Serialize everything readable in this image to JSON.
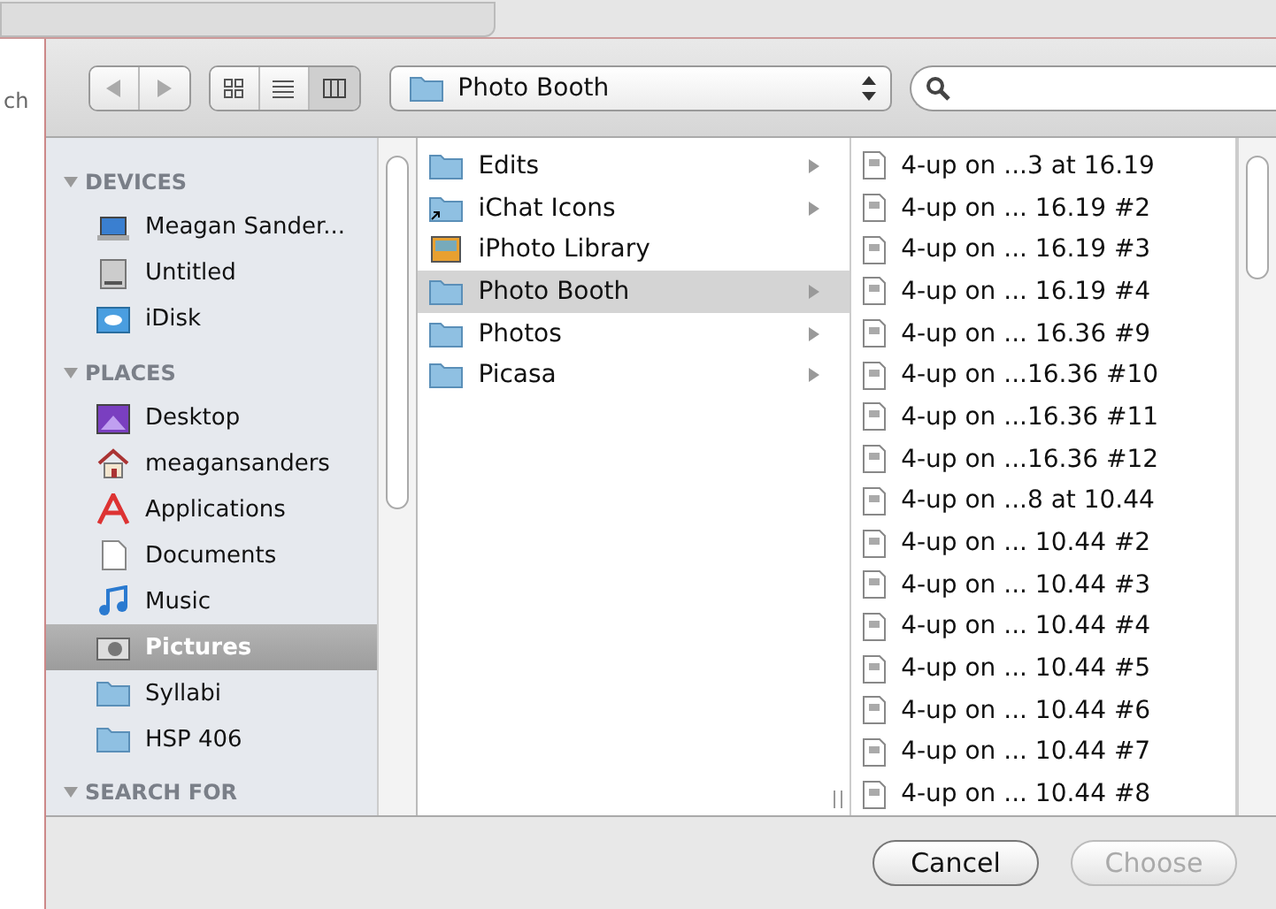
{
  "background": {
    "side_text": "ch"
  },
  "toolbar": {
    "nav": [
      {
        "kind": "back",
        "disabled": true
      },
      {
        "kind": "forward",
        "disabled": true
      }
    ],
    "views": [
      {
        "kind": "icons",
        "selected": false
      },
      {
        "kind": "list",
        "selected": false
      },
      {
        "kind": "columns",
        "selected": true
      }
    ],
    "location": "Photo Booth"
  },
  "sidebar": [
    {
      "heading": "DEVICES",
      "expanded": true,
      "items": [
        {
          "label": "Meagan Sander...",
          "kind": "laptop",
          "selected": false
        },
        {
          "label": "Untitled",
          "kind": "drive",
          "selected": false
        },
        {
          "label": "iDisk",
          "kind": "idisk",
          "selected": false
        }
      ]
    },
    {
      "heading": "PLACES",
      "expanded": true,
      "items": [
        {
          "label": "Desktop",
          "kind": "desktop",
          "selected": false
        },
        {
          "label": "meagansanders",
          "kind": "home",
          "selected": false
        },
        {
          "label": "Applications",
          "kind": "applications",
          "selected": false
        },
        {
          "label": "Documents",
          "kind": "documents",
          "selected": false
        },
        {
          "label": "Music",
          "kind": "music",
          "selected": false
        },
        {
          "label": "Pictures",
          "kind": "pictures",
          "selected": true
        },
        {
          "label": "Syllabi",
          "kind": "folder",
          "selected": false
        },
        {
          "label": "HSP 406",
          "kind": "folder",
          "selected": false
        }
      ]
    },
    {
      "heading": "SEARCH FOR",
      "expanded": true
    }
  ],
  "column_1": [
    {
      "label": "Edits",
      "kind": "folder",
      "expandable": true,
      "selected": false
    },
    {
      "label": "iChat Icons",
      "kind": "alias",
      "expandable": true,
      "selected": false
    },
    {
      "label": "iPhoto Library",
      "kind": "library",
      "expandable": false,
      "selected": false
    },
    {
      "label": "Photo Booth",
      "kind": "folder",
      "expandable": true,
      "selected": true
    },
    {
      "label": "Photos",
      "kind": "folder",
      "expandable": true,
      "selected": false
    },
    {
      "label": "Picasa",
      "kind": "folder",
      "expandable": true,
      "selected": false
    }
  ],
  "column_2": [
    {
      "label": "4-up on ...3 at 16.19"
    },
    {
      "label": "4-up on ... 16.19 #2"
    },
    {
      "label": "4-up on ... 16.19 #3"
    },
    {
      "label": "4-up on ... 16.19 #4"
    },
    {
      "label": "4-up on ... 16.36 #9"
    },
    {
      "label": "4-up on ...16.36 #10"
    },
    {
      "label": "4-up on ...16.36 #11"
    },
    {
      "label": "4-up on ...16.36 #12"
    },
    {
      "label": "4-up on ...8 at 10.44"
    },
    {
      "label": "4-up on ... 10.44 #2"
    },
    {
      "label": "4-up on ... 10.44 #3"
    },
    {
      "label": "4-up on ... 10.44 #4"
    },
    {
      "label": "4-up on ... 10.44 #5"
    },
    {
      "label": "4-up on ... 10.44 #6"
    },
    {
      "label": "4-up on ... 10.44 #7"
    },
    {
      "label": "4-up on ... 10.44 #8"
    }
  ],
  "buttons": [
    {
      "label": "Cancel",
      "disabled": false
    },
    {
      "label": "Choose",
      "disabled": true
    }
  ]
}
